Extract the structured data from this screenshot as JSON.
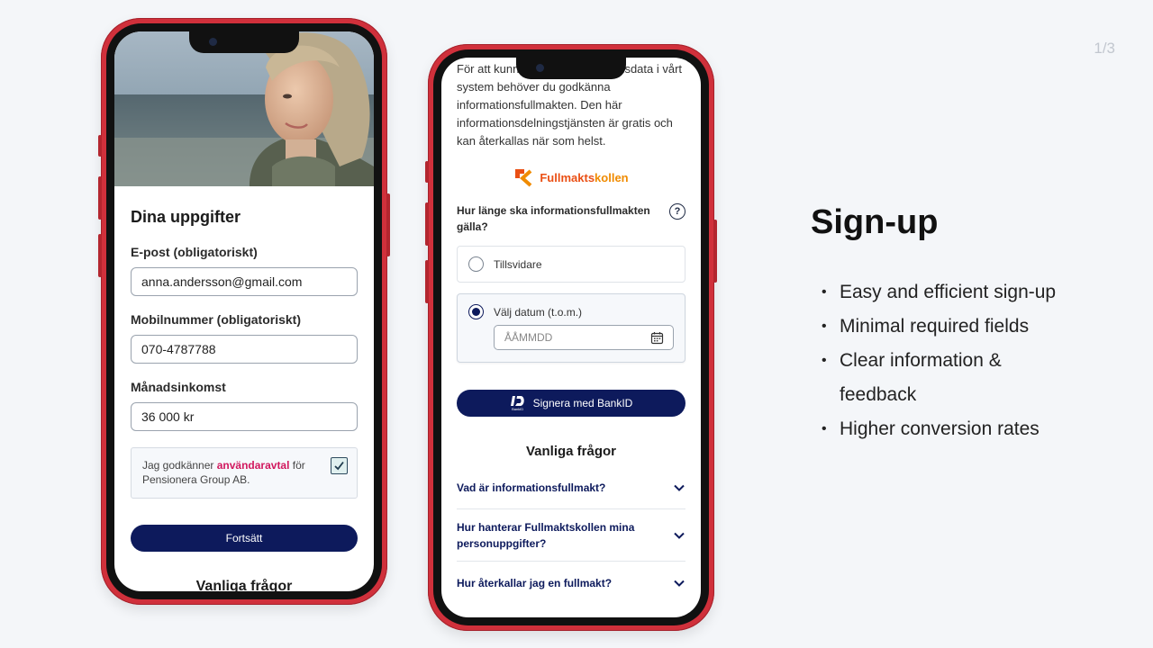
{
  "pager": "1/3",
  "phone1": {
    "title": "Dina uppgifter",
    "fields": [
      {
        "label": "E-post (obligatoriskt)",
        "value": "anna.andersson@gmail.com"
      },
      {
        "label": "Mobilnummer (obligatoriskt)",
        "value": "070-4787788"
      },
      {
        "label": "Månadsinkomst",
        "value": "36 000 kr"
      }
    ],
    "consent": {
      "prefix": "Jag godkänner ",
      "link": "användaravtal",
      "suffix": " för Pensionera Group AB.",
      "checked": true
    },
    "continue_label": "Fortsätt",
    "faq_title": "Vanliga frågor"
  },
  "phone2": {
    "intro": "För att kunna hämta din pensionsdata i vårt system behöver du godkänna informationsfullmakten. Den här informationsdelningstjänsten är gratis och kan återkallas när som helst.",
    "brand": {
      "part1": "Fullmakts",
      "part2": "kollen"
    },
    "question": "Hur länge ska informationsfullmakten gälla?",
    "help_symbol": "?",
    "options": [
      {
        "label": "Tillsvidare",
        "selected": false
      },
      {
        "label": "Välj datum (t.o.m.)",
        "selected": true
      }
    ],
    "date_placeholder": "ÅÅMMDD",
    "bankid_button": "Signera med BankID",
    "bankid_logo_text": "BankID",
    "faq_title": "Vanliga frågor",
    "faq": [
      "Vad är informationsfullmakt?",
      "Hur hanterar Fullmaktskollen mina personuppgifter?",
      "Hur återkallar jag en fullmakt?"
    ]
  },
  "side": {
    "title": "Sign-up",
    "bullets": [
      "Easy and efficient sign-up",
      "Minimal required fields",
      "Clear information & feedback",
      "Higher conversion rates"
    ]
  },
  "colors": {
    "frame": "#d0303b",
    "navy": "#0d1a5c",
    "link": "#d1185e",
    "brand_orange": "#ea4f14"
  }
}
